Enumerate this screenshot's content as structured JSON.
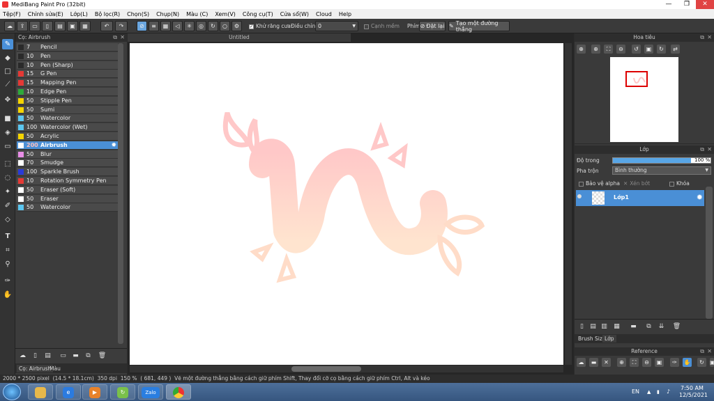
{
  "window": {
    "title": "MediBang Paint Pro (32bit)",
    "minimize": "—",
    "maximize": "❐",
    "close": "✕"
  },
  "menu": [
    "Tệp(F)",
    "Chỉnh sửa(E)",
    "Lớp(L)",
    "Bộ lọc(R)",
    "Chọn(S)",
    "Chụp(N)",
    "Màu (C)",
    "Xem(V)",
    "Công cụ(T)",
    "Cửa sổ(W)",
    "Cloud",
    "Help"
  ],
  "toolbar": {
    "antialias_label": "Khử răng cưa",
    "correction_label": "Điều chỉnh",
    "correction_value": "0",
    "edge_label": "Cạnh mềm",
    "key_label": "Phím",
    "reset_label": "Đặt lại",
    "straight_line_label": "Tạo một đường thẳng"
  },
  "brush_panel": {
    "title": "Cọ: Airbrush",
    "brushes": [
      {
        "size": "7",
        "name": "Pencil",
        "color": "#2a2a2a"
      },
      {
        "size": "10",
        "name": "Pen",
        "color": "#2a2a2a"
      },
      {
        "size": "10",
        "name": "Pen (Sharp)",
        "color": "#2a2a2a"
      },
      {
        "size": "15",
        "name": "G Pen",
        "color": "#e53935"
      },
      {
        "size": "15",
        "name": "Mapping Pen",
        "color": "#e53935"
      },
      {
        "size": "10",
        "name": "Edge Pen",
        "color": "#2eaa3a"
      },
      {
        "size": "50",
        "name": "Stipple Pen",
        "color": "#f5d400"
      },
      {
        "size": "50",
        "name": "Sumi",
        "color": "#f5d400"
      },
      {
        "size": "50",
        "name": "Watercolor",
        "color": "#5bc6f0"
      },
      {
        "size": "100",
        "name": "Watercolor (Wet)",
        "color": "#5bc6f0"
      },
      {
        "size": "50",
        "name": "Acrylic",
        "color": "#f5d400"
      },
      {
        "size": "200",
        "name": "Airbrush",
        "color": "#ffffff",
        "selected": true
      },
      {
        "size": "50",
        "name": "Blur",
        "color": "#e88ee6"
      },
      {
        "size": "70",
        "name": "Smudge",
        "color": "#ffffff"
      },
      {
        "size": "100",
        "name": "Sparkle Brush",
        "color": "#2a3ad8"
      },
      {
        "size": "10",
        "name": "Rotation Symmetry Pen",
        "color": "#e53935"
      },
      {
        "size": "50",
        "name": "Eraser (Soft)",
        "color": "#ffffff"
      },
      {
        "size": "50",
        "name": "Eraser",
        "color": "#ffffff"
      },
      {
        "size": "50",
        "name": "Watercolor",
        "color": "#5bc6f0"
      }
    ],
    "tabs": [
      "Cọ: Airbrush",
      "Màu"
    ]
  },
  "document": {
    "tab_title": "Untitled"
  },
  "navigator": {
    "title": "Hoa tiêu"
  },
  "layer_panel": {
    "title": "Lớp",
    "opacity_label": "Độ trong",
    "opacity_value": "100 %",
    "opacity_fraction": 0.8,
    "blend_label": "Pha trộn",
    "blend_value": "Bình thường",
    "protect_alpha": "Bảo vệ alpha",
    "clipping": "Xén bớt",
    "lock": "Khóa",
    "layer_name": "Lớp1",
    "tabs": [
      "Brush Size",
      "Lớp"
    ]
  },
  "reference": {
    "title": "Reference"
  },
  "status": {
    "size": "2000 * 2500 pixel",
    "cm": "(14.5 * 18.1cm)",
    "dpi": "350 dpi",
    "zoom": "150 %",
    "coords": "( 681, 449 )",
    "hint": "Vẽ một đường thẳng bằng cách giữ phím Shift, Thay đổi cỡ cọ bằng cách giữ phím Ctrl, Alt và kéo"
  },
  "taskbar": {
    "lang": "EN",
    "time": "7:50 AM",
    "date": "12/5/2021",
    "zalo": "Zalo"
  }
}
